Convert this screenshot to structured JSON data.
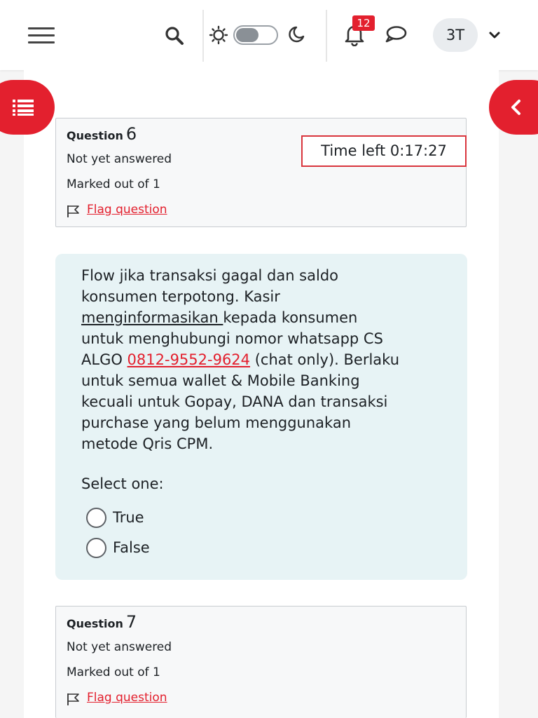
{
  "navbar": {
    "notifications_count": "12",
    "avatar_initials": "3T"
  },
  "questions": [
    {
      "label": "Question",
      "number": "6",
      "state": "Not yet answered",
      "grade": "Marked out of 1",
      "flag_label": "Flag question"
    },
    {
      "label": "Question",
      "number": "7",
      "state": "Not yet answered",
      "grade": "Marked out of 1",
      "flag_label": "Flag question"
    }
  ],
  "timer": {
    "text": "Time left 0:17:27"
  },
  "question6": {
    "text_lines": {
      "l1": "Flow jika transaksi gagal dan saldo",
      "l2": "konsumen terpotong. Kasir",
      "l3_u": "menginformasikan ",
      "l3_a": "kepada ",
      "l3_u2": " ",
      "l3_b": "konsumen",
      "l4": "untuk menghubungi nomor whatsapp CS",
      "l5_a": "ALGO ",
      "l5_phone": "0812-9552-9624",
      "l5_b": " (chat only). Berlaku",
      "l6": "untuk semua wallet & Mobile Banking",
      "l7": "kecuali untuk Gopay, DANA dan transaksi",
      "l8": "purchase yang belum menggunakan",
      "l9": "metode Qris CPM."
    },
    "prompt": "Select one:",
    "options": [
      {
        "label": "True",
        "selected": false
      },
      {
        "label": "False",
        "selected": false
      }
    ]
  },
  "colors": {
    "accent": "#e3202e",
    "info_bg": "#f7f8f9",
    "question_bg": "#e7f3f5"
  }
}
